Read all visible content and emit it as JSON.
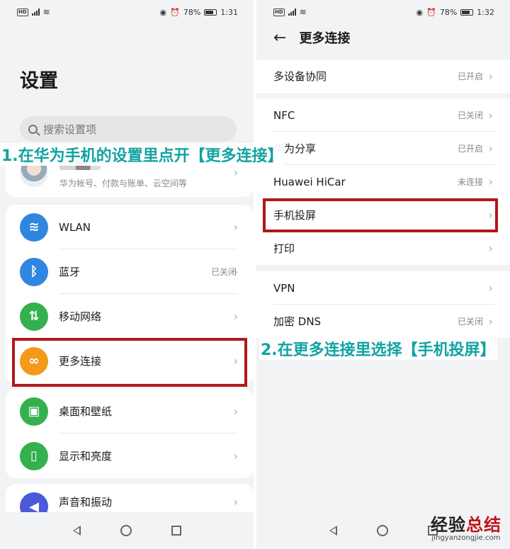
{
  "left_screen": {
    "status": {
      "percent": "78%",
      "time": "1:31"
    },
    "title": "设置",
    "search_placeholder": "搜索设置项",
    "account_sub": "华为帐号、付款与账单、云空间等",
    "rows": [
      {
        "label": "WLAN",
        "value": "",
        "icon": "wifi-icon",
        "color": "#2e86e0"
      },
      {
        "label": "蓝牙",
        "value": "已关闭",
        "icon": "bluetooth-icon",
        "color": "#2e86e0"
      },
      {
        "label": "移动网络",
        "value": "",
        "icon": "mobile-network-icon",
        "color": "#35b04e"
      },
      {
        "label": "更多连接",
        "value": "",
        "icon": "link-icon",
        "color": "#f39a1c"
      },
      {
        "label": "桌面和壁纸",
        "value": "",
        "icon": "wallpaper-icon",
        "color": "#35b04e"
      },
      {
        "label": "显示和亮度",
        "value": "",
        "icon": "display-icon",
        "color": "#35b04e"
      },
      {
        "label": "声音和振动",
        "value": "",
        "icon": "sound-icon",
        "color": "#4a5ad8"
      }
    ]
  },
  "right_screen": {
    "status": {
      "percent": "78%",
      "time": "1:32"
    },
    "title": "更多连接",
    "groups": [
      [
        {
          "label": "多设备协同",
          "value": "已开启"
        }
      ],
      [
        {
          "label": "NFC",
          "value": "已关闭"
        },
        {
          "label": "华为分享",
          "value": "已开启"
        },
        {
          "label": "Huawei HiCar",
          "value": "未连接"
        },
        {
          "label": "手机投屏",
          "value": ""
        },
        {
          "label": "打印",
          "value": ""
        }
      ],
      [
        {
          "label": "VPN",
          "value": ""
        },
        {
          "label": "加密 DNS",
          "value": "已关闭"
        }
      ]
    ]
  },
  "captions": {
    "step1": "1.在华为手机的设置里点开【更多连接】",
    "step2": "2.在更多连接里选择【手机投屏】"
  },
  "watermark": {
    "main_a": "经验",
    "main_b": "总结",
    "sub": "jingyanzongjie.com"
  },
  "colors": {
    "highlight": "#b0181d",
    "caption": "#12a3a3"
  }
}
